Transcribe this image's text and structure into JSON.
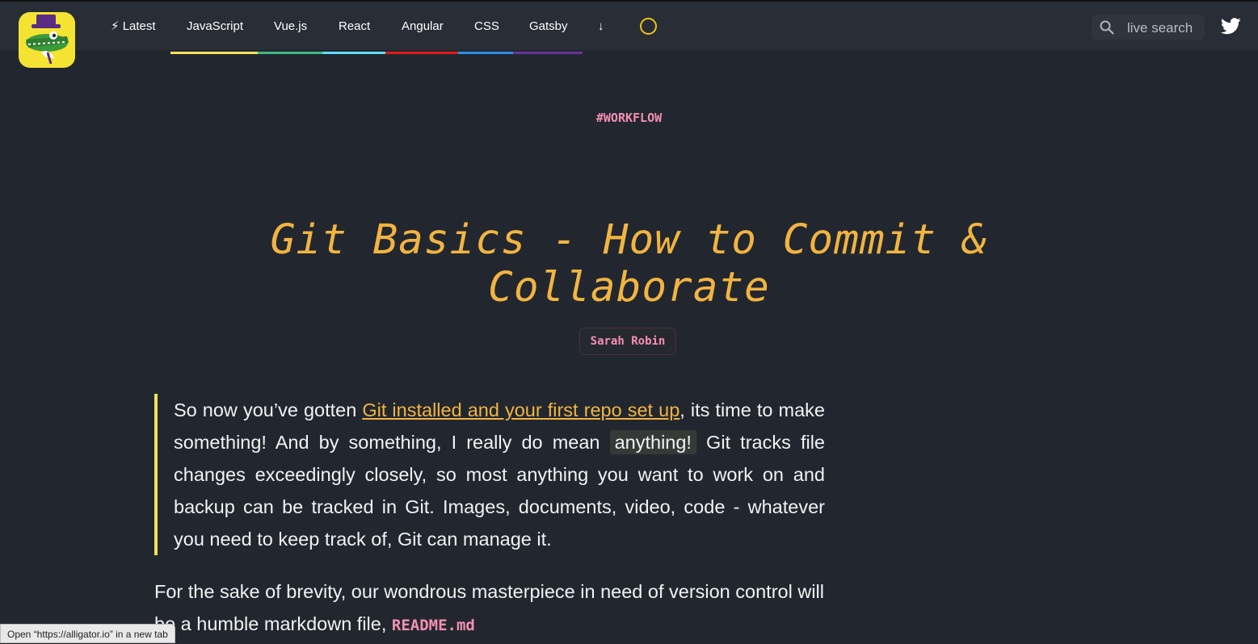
{
  "nav": {
    "items": [
      {
        "label": "⚡ Latest",
        "color": ""
      },
      {
        "label": "JavaScript",
        "color": "#f4e05a"
      },
      {
        "label": "Vue.js",
        "color": "#41b883"
      },
      {
        "label": "React",
        "color": "#61dafb"
      },
      {
        "label": "Angular",
        "color": "#dd1b16"
      },
      {
        "label": "CSS",
        "color": "#2c8ce5"
      },
      {
        "label": "Gatsby",
        "color": "#663399"
      },
      {
        "label": "↓",
        "color": ""
      }
    ],
    "search_placeholder": "live search"
  },
  "article": {
    "tag": "#WORKFLOW",
    "title_line1": "Git Basics - How to Commit &",
    "title_line2": "Collaborate",
    "author": "Sarah Robin",
    "quote": {
      "before_link": "So now you’ve gotten ",
      "link_text": "Git installed and your first repo set up",
      "after_link": ", its time to make something! And by something, I really do mean ",
      "highlight": "anything!",
      "after_highlight": " Git tracks file changes exceedingly closely, so most anything you want to work on and backup can be tracked in Git. Images, documents, video, code - whatever you need to keep track of, Git can manage it."
    },
    "para": {
      "text": "For the sake of brevity, our wondrous masterpiece in need of version control will be a humble markdown file, ",
      "code": "README.md"
    }
  },
  "status_bar": "Open “https://alligator.io” in a new tab",
  "colors": {
    "background": "#22272f",
    "accent": "#f2b441",
    "pink": "#f48fb1",
    "quote_bar": "#f4e05a"
  },
  "icons": [
    "alligator-logo",
    "search-icon",
    "twitter-icon",
    "loading-spinner-icon"
  ]
}
